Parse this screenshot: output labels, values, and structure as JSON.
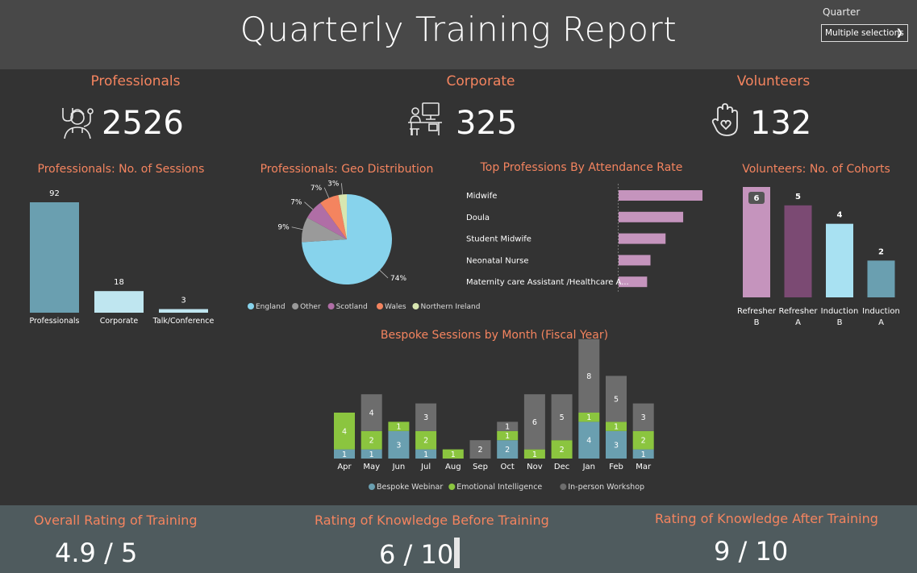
{
  "header": {
    "title": "Quarterly Training Report",
    "quarter_label": "Quarter",
    "quarter_value": "Multiple selections"
  },
  "kpis": {
    "professionals": {
      "label": "Professionals",
      "value": "2526",
      "icon": "doctor-icon"
    },
    "corporate": {
      "label": "Corporate",
      "value": "325",
      "icon": "office-desk-icon"
    },
    "volunteers": {
      "label": "Volunteers",
      "value": "132",
      "icon": "hand-heart-icon"
    }
  },
  "section_titles": {
    "sessions": "Professionals: No. of Sessions",
    "geo": "Professionals: Geo Distribution",
    "top_prof": "Top Professions By Attendance Rate",
    "cohorts": "Volunteers: No. of Cohorts",
    "monthly": "Bespoke Sessions by Month (Fiscal Year)"
  },
  "ratings": {
    "overall": {
      "label": "Overall Rating of Training",
      "value": "4.9 / 5"
    },
    "before": {
      "label": "Rating of Knowledge Before Training",
      "value": "6  / 10"
    },
    "after": {
      "label": "Rating of Knowledge After Training",
      "value": "9  / 10"
    }
  },
  "colors": {
    "accent": "#f4845f",
    "teal": "#6a9fb0",
    "light_blue": "#bfe6f0",
    "sky": "#a8e1f2",
    "pink": "#c594bd",
    "plum": "#7b4a73",
    "green": "#8bc53f",
    "grey": "#6d6d6d"
  },
  "chart_data": [
    {
      "id": "sessions",
      "type": "bar",
      "categories": [
        "Professionals",
        "Corporate",
        "Talk/Conference"
      ],
      "values": [
        92,
        18,
        3
      ],
      "colors": [
        "#6a9fb0",
        "#bfe6f0",
        "#bfe6f0"
      ],
      "ylim": [
        0,
        92
      ]
    },
    {
      "id": "geo",
      "type": "pie",
      "labels": [
        "England",
        "Other",
        "Scotland",
        "Wales",
        "Northern Ireland"
      ],
      "values": [
        74,
        9,
        7,
        7,
        3
      ],
      "value_labels": [
        "74%",
        "9%",
        "7%",
        "7%",
        "3%"
      ],
      "colors": [
        "#87d3ec",
        "#9a9a9a",
        "#b06ea6",
        "#f4845f",
        "#d8e6b0"
      ],
      "legend": "bottom"
    },
    {
      "id": "top_prof",
      "type": "bar",
      "orientation": "horizontal",
      "categories": [
        "Midwife",
        "Doula",
        "Student Midwife",
        "Neonatal Nurse",
        "Maternity care Assistant /Healthcare A..."
      ],
      "values": [
        1.0,
        0.77,
        0.56,
        0.38,
        0.34
      ],
      "color": "#c594bd"
    },
    {
      "id": "cohorts",
      "type": "bar",
      "categories": [
        "Refresher B",
        "Refresher A",
        "Induction B",
        "Induction A"
      ],
      "category_lines": [
        [
          "Refresher",
          "B"
        ],
        [
          "Refresher",
          "A"
        ],
        [
          "Induction",
          "B"
        ],
        [
          "Induction",
          "A"
        ]
      ],
      "values": [
        6,
        5,
        4,
        2
      ],
      "colors": [
        "#c594bd",
        "#7b4a73",
        "#a8e1f2",
        "#6a9fb0"
      ],
      "ylim": [
        0,
        6
      ]
    },
    {
      "id": "monthly",
      "type": "bar",
      "stacked": true,
      "categories": [
        "Apr",
        "May",
        "Jun",
        "Jul",
        "Aug",
        "Sep",
        "Oct",
        "Nov",
        "Dec",
        "Jan",
        "Feb",
        "Mar"
      ],
      "series": [
        {
          "name": "Bespoke Webinar",
          "color": "#6a9fb0",
          "values": [
            1,
            1,
            3,
            1,
            0,
            0,
            2,
            0,
            0,
            4,
            3,
            1
          ]
        },
        {
          "name": "Emotional Intelligence",
          "color": "#8bc53f",
          "values": [
            4,
            2,
            1,
            2,
            1,
            0,
            1,
            1,
            2,
            1,
            1,
            2
          ]
        },
        {
          "name": "In-person Workshop",
          "color": "#6d6d6d",
          "values": [
            0,
            4,
            0,
            3,
            0,
            2,
            1,
            6,
            5,
            8,
            5,
            3
          ]
        }
      ],
      "legend": "bottom"
    }
  ]
}
